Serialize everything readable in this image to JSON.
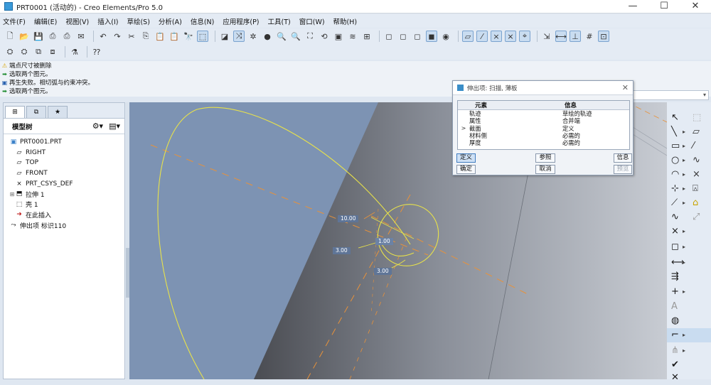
{
  "window": {
    "title": "PRT0001 (活动的) - Creo Elements/Pro 5.0",
    "controls": [
      "—",
      "☐",
      "✕"
    ]
  },
  "menu": [
    "文件(F)",
    "编辑(E)",
    "视图(V)",
    "插入(I)",
    "草绘(S)",
    "分析(A)",
    "信息(N)",
    "应用程序(P)",
    "工具(T)",
    "窗口(W)",
    "帮助(H)"
  ],
  "messages": [
    {
      "icon": "warning-icon",
      "text": "端点尺寸被删除"
    },
    {
      "icon": "arrow-icon",
      "text": "选取两个图元。"
    },
    {
      "icon": "constraint-icon",
      "text": "再生失败。相切弧与约束冲突。"
    },
    {
      "icon": "arrow-icon",
      "text": "选取两个图元。"
    }
  ],
  "model_tree": {
    "header": "模型树",
    "items": [
      {
        "label": "PRT0001.PRT",
        "icon": "part-icon",
        "level": 0
      },
      {
        "label": "RIGHT",
        "icon": "datum-plane-icon",
        "level": 1
      },
      {
        "label": "TOP",
        "icon": "datum-plane-icon",
        "level": 1
      },
      {
        "label": "FRONT",
        "icon": "datum-plane-icon",
        "level": 1
      },
      {
        "label": "PRT_CSYS_DEF",
        "icon": "csys-icon",
        "level": 1
      },
      {
        "label": "拉伸 1",
        "icon": "extrude-icon",
        "level": 1,
        "expandable": true
      },
      {
        "label": "壳 1",
        "icon": "shell-icon",
        "level": 1
      },
      {
        "label": "在此插入",
        "icon": "insert-here-icon",
        "level": 1
      },
      {
        "label": "伸出项 标识110",
        "icon": "protrusion-icon",
        "level": 1
      }
    ]
  },
  "dialog": {
    "title": "伸出项: 扫描, 薄板",
    "columns": [
      "元素",
      "信息"
    ],
    "rows": [
      {
        "element": "轨迹",
        "info": "草绘的轨迹",
        "current": false
      },
      {
        "element": "属性",
        "info": "合并端",
        "current": false
      },
      {
        "element": "截面",
        "info": "定义",
        "current": true
      },
      {
        "element": "材料侧",
        "info": "必需的",
        "current": false
      },
      {
        "element": "厚度",
        "info": "必需的",
        "current": false
      }
    ],
    "buttons": {
      "define": "定义",
      "reference": "参照",
      "info": "信息",
      "ok": "确定",
      "cancel": "取消",
      "preview": "预览"
    },
    "marker": ">"
  },
  "dimensions": {
    "d1": "10.00",
    "d2": "3.00",
    "d3": "3.00",
    "d4": "1.00"
  },
  "colors": {
    "viewport_bg": "#7d93b3",
    "sketch_line": "#e8e24a",
    "centerline": "#e8923a"
  }
}
